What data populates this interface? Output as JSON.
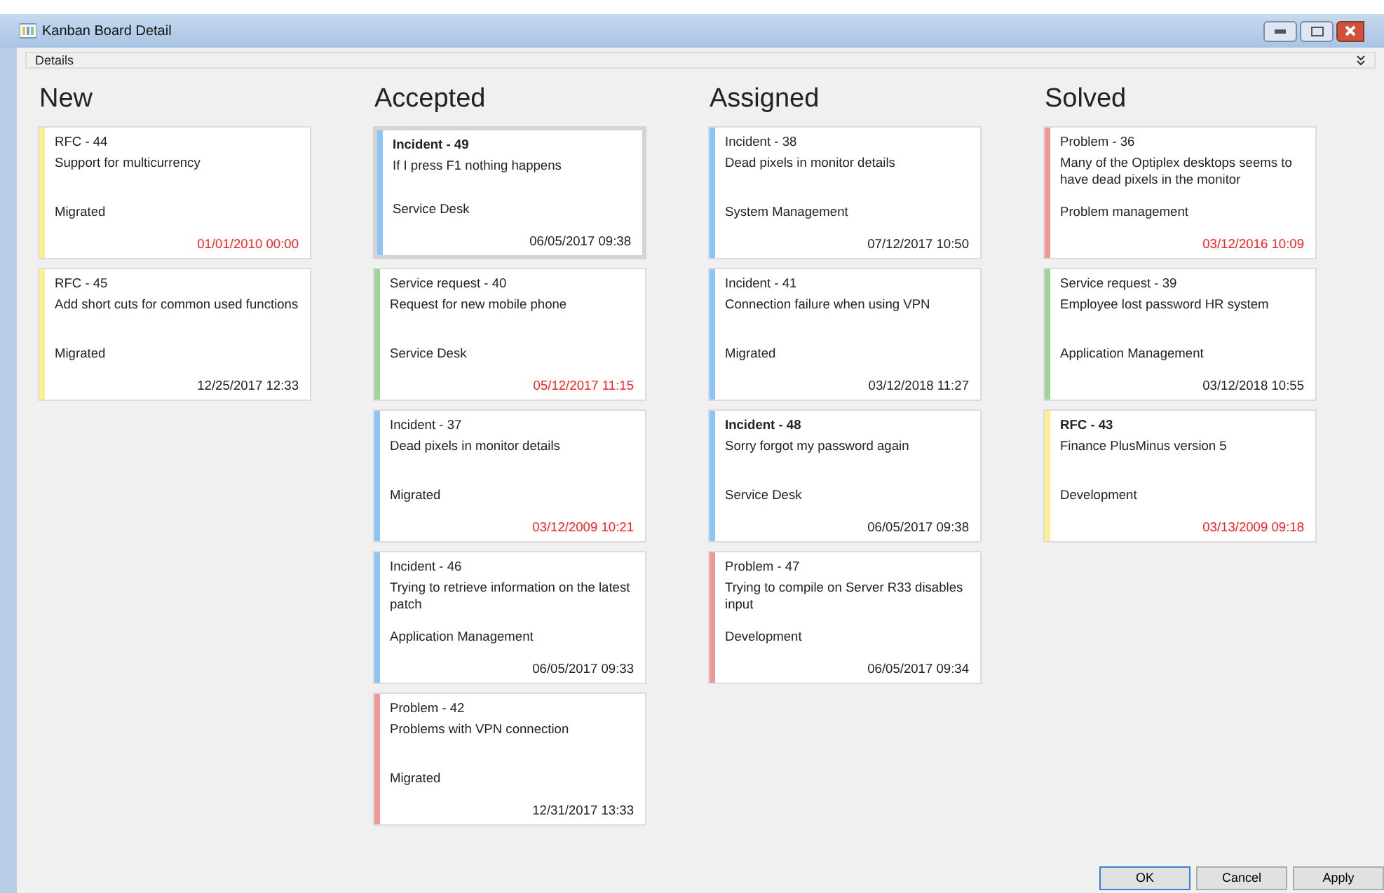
{
  "window": {
    "title": "Kanban Board Detail"
  },
  "section": {
    "title": "Details"
  },
  "columns": [
    {
      "title": "New",
      "cards": [
        {
          "title": "RFC - 44",
          "description": "Support for multicurrency",
          "group": "Migrated",
          "date": "01/01/2010 00:00",
          "overdue": true,
          "emphasized": false,
          "selected": false,
          "color": "#fbef8f"
        },
        {
          "title": "RFC - 45",
          "description": "Add short cuts for common used functions",
          "group": "Migrated",
          "date": "12/25/2017 12:33",
          "overdue": false,
          "emphasized": false,
          "selected": false,
          "color": "#fbef8f"
        }
      ]
    },
    {
      "title": "Accepted",
      "cards": [
        {
          "title": "Incident - 49",
          "description": "If I press F1 nothing happens",
          "group": "Service Desk",
          "date": "06/05/2017 09:38",
          "overdue": false,
          "emphasized": true,
          "selected": true,
          "color": "#8cc4f5"
        },
        {
          "title": "Service request - 40",
          "description": "Request for new mobile phone",
          "group": "Service Desk",
          "date": "05/12/2017 11:15",
          "overdue": true,
          "emphasized": false,
          "selected": false,
          "color": "#9fd49a"
        },
        {
          "title": "Incident - 37",
          "description": "Dead pixels in monitor details",
          "group": "Migrated",
          "date": "03/12/2009 10:21",
          "overdue": true,
          "emphasized": false,
          "selected": false,
          "color": "#8cc4f5"
        },
        {
          "title": "Incident - 46",
          "description": "Trying to retrieve information on the latest patch",
          "group": "Application Management",
          "date": "06/05/2017 09:33",
          "overdue": false,
          "emphasized": false,
          "selected": false,
          "color": "#8cc4f5"
        },
        {
          "title": "Problem - 42",
          "description": "Problems with VPN connection",
          "group": "Migrated",
          "date": "12/31/2017 13:33",
          "overdue": false,
          "emphasized": false,
          "selected": false,
          "color": "#ee9898"
        }
      ]
    },
    {
      "title": "Assigned",
      "cards": [
        {
          "title": "Incident - 38",
          "description": "Dead pixels in monitor details",
          "group": "System Management",
          "date": "07/12/2017 10:50",
          "overdue": false,
          "emphasized": false,
          "selected": false,
          "color": "#8cc4f5"
        },
        {
          "title": "Incident - 41",
          "description": "Connection failure when using VPN",
          "group": "Migrated",
          "date": "03/12/2018 11:27",
          "overdue": false,
          "emphasized": false,
          "selected": false,
          "color": "#8cc4f5"
        },
        {
          "title": "Incident - 48",
          "description": "Sorry forgot my password again",
          "group": "Service Desk",
          "date": "06/05/2017 09:38",
          "overdue": false,
          "emphasized": true,
          "selected": false,
          "color": "#8cc4f5"
        },
        {
          "title": "Problem - 47",
          "description": "Trying to compile on Server R33 disables input",
          "group": "Development",
          "date": "06/05/2017 09:34",
          "overdue": false,
          "emphasized": false,
          "selected": false,
          "color": "#ee9898"
        }
      ]
    },
    {
      "title": "Solved",
      "cards": [
        {
          "title": "Problem - 36",
          "description": "Many of the Optiplex desktops seems to have dead pixels in the monitor",
          "group": "Problem management",
          "date": "03/12/2016 10:09",
          "overdue": true,
          "emphasized": false,
          "selected": false,
          "color": "#ee9898"
        },
        {
          "title": "Service request - 39",
          "description": "Employee lost password HR system",
          "group": "Application Management",
          "date": "03/12/2018 10:55",
          "overdue": false,
          "emphasized": false,
          "selected": false,
          "color": "#9fd49a"
        },
        {
          "title": "RFC - 43",
          "description": "Finance PlusMinus version 5",
          "group": "Development",
          "date": "03/13/2009 09:18",
          "overdue": true,
          "emphasized": true,
          "selected": false,
          "color": "#fbef8f"
        }
      ]
    }
  ],
  "buttons": [
    {
      "label": "OK",
      "default": true
    },
    {
      "label": "Cancel",
      "default": false
    },
    {
      "label": "Apply",
      "default": false
    }
  ]
}
